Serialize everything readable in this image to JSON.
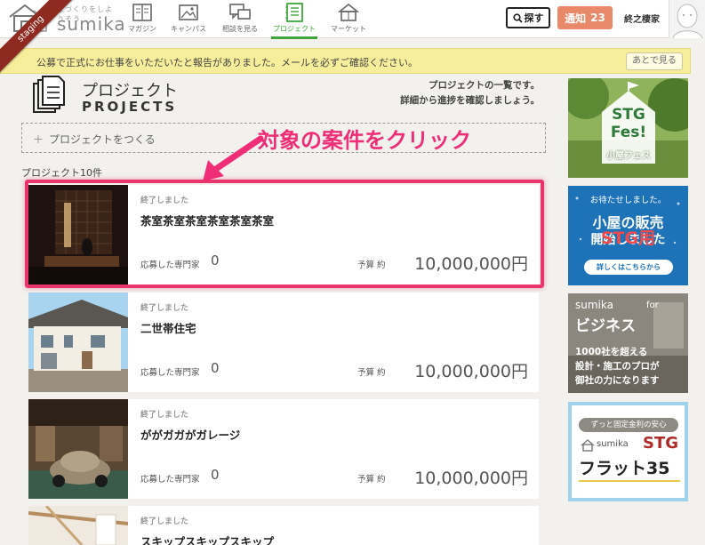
{
  "header": {
    "logo_tagline": "家づくりをしようそう",
    "logo_text": "sumika",
    "nav": [
      {
        "label": "マガジン"
      },
      {
        "label": "キャンパス"
      },
      {
        "label": "相談を見る"
      },
      {
        "label": "プロジェクト"
      },
      {
        "label": "マーケット"
      }
    ],
    "search_label": "探す",
    "notice_label": "通知",
    "notice_count": "23",
    "user_name": "終之棲家"
  },
  "ribbon": "staging",
  "alert": {
    "text": "公募で正式にお仕事をいただいたと報告がありました。メールを必ずご確認ください。",
    "later_label": "あとで見る"
  },
  "page": {
    "title_jp": "プロジェクト",
    "title_en": "PROJECTS",
    "desc_line1": "プロジェクトの一覧です。",
    "desc_line2": "詳細から進捗を確認しましょう。",
    "create_label": "プロジェクトをつくる",
    "count_label": "プロジェクト10件"
  },
  "annotation": "対象の案件をクリック",
  "projects": [
    {
      "status": "終了しました",
      "title": "茶室茶室茶室茶室茶室茶室",
      "applied_label": "応募した専門家",
      "applied": "0",
      "budget_label": "予算 約",
      "budget": "10,000,000円"
    },
    {
      "status": "終了しました",
      "title": "二世帯住宅",
      "applied_label": "応募した専門家",
      "applied": "0",
      "budget_label": "予算 約",
      "budget": "10,000,000円"
    },
    {
      "status": "終了しました",
      "title": "ががガガがガレージ",
      "applied_label": "応募した専門家",
      "applied": "0",
      "budget_label": "予算 約",
      "budget": "10,000,000円"
    },
    {
      "status": "終了しました",
      "title": "スキップスキップスキップ"
    }
  ],
  "sidebar": {
    "fes": {
      "line1": "STG",
      "line2": "Fes!",
      "line3": "小屋フェス"
    },
    "sale": {
      "line1": "お待たせしました。",
      "line2": "小屋の販売",
      "line3": "開始しました",
      "overlay": "STG用",
      "button": "詳しくはこちらから"
    },
    "business": {
      "brand": "sumika",
      "for": "for",
      "title": "ビジネス",
      "line1": "1000社を超える",
      "line2": "設計・施工のプロが",
      "line3": "御社の力になります"
    },
    "flat": {
      "tag": "ずっと固定金利の安心",
      "brand": "sumika",
      "stg": "STG",
      "title": "フラット35"
    }
  },
  "colors": {
    "accent_green": "#3fa53b",
    "notice": "#e8896a",
    "highlight": "#e8366c",
    "alert_bg": "#f6ee9a"
  }
}
